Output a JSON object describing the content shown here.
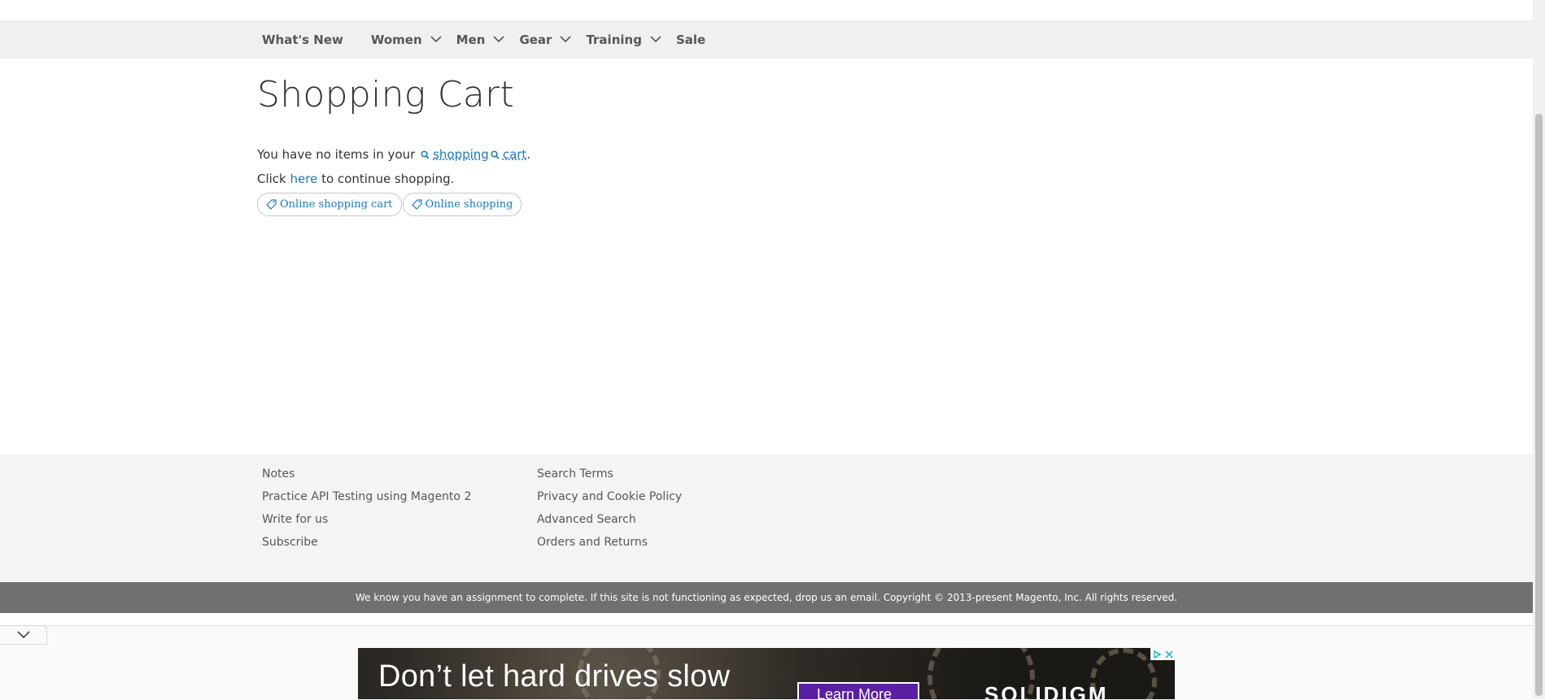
{
  "nav": {
    "items": [
      {
        "label": "What's New",
        "has_submenu": false
      },
      {
        "label": "Women",
        "has_submenu": true
      },
      {
        "label": "Men",
        "has_submenu": true
      },
      {
        "label": "Gear",
        "has_submenu": true
      },
      {
        "label": "Training",
        "has_submenu": true
      },
      {
        "label": "Sale",
        "has_submenu": false
      }
    ]
  },
  "main": {
    "title": "Shopping Cart",
    "empty_prefix": "You have no items in your",
    "kw_shopping": "shopping",
    "kw_cart": "cart",
    "empty_suffix": ".",
    "continue_prefix": "Click",
    "continue_link": "here",
    "continue_suffix": "to continue shopping."
  },
  "chips": [
    "Online shopping cart",
    "Online shopping"
  ],
  "footer": {
    "col1": [
      "Notes",
      "Practice API Testing using Magento 2",
      "Write for us",
      "Subscribe"
    ],
    "col2": [
      "Search Terms",
      "Privacy and Cookie Policy",
      "Advanced Search",
      "Orders and Returns"
    ]
  },
  "copyright": "We know you have an assignment to complete. If this site is not functioning as expected, drop us an email. Copyright © 2013-present Magento, Inc. All rights reserved.",
  "ad": {
    "headline": "Don’t let hard drives slow",
    "cta": "Learn More",
    "brand": "SOLIDIGM"
  },
  "colors": {
    "link": "#1979c3",
    "nav_bg": "#f0f0f0",
    "footer_bg": "#f4f4f4",
    "copyright_bg": "#6e716e",
    "ad_cta": "#5a1fa3"
  },
  "icons": [
    "chevron-down-icon",
    "search-icon",
    "tag-icon",
    "adchoices-icon",
    "close-icon"
  ]
}
